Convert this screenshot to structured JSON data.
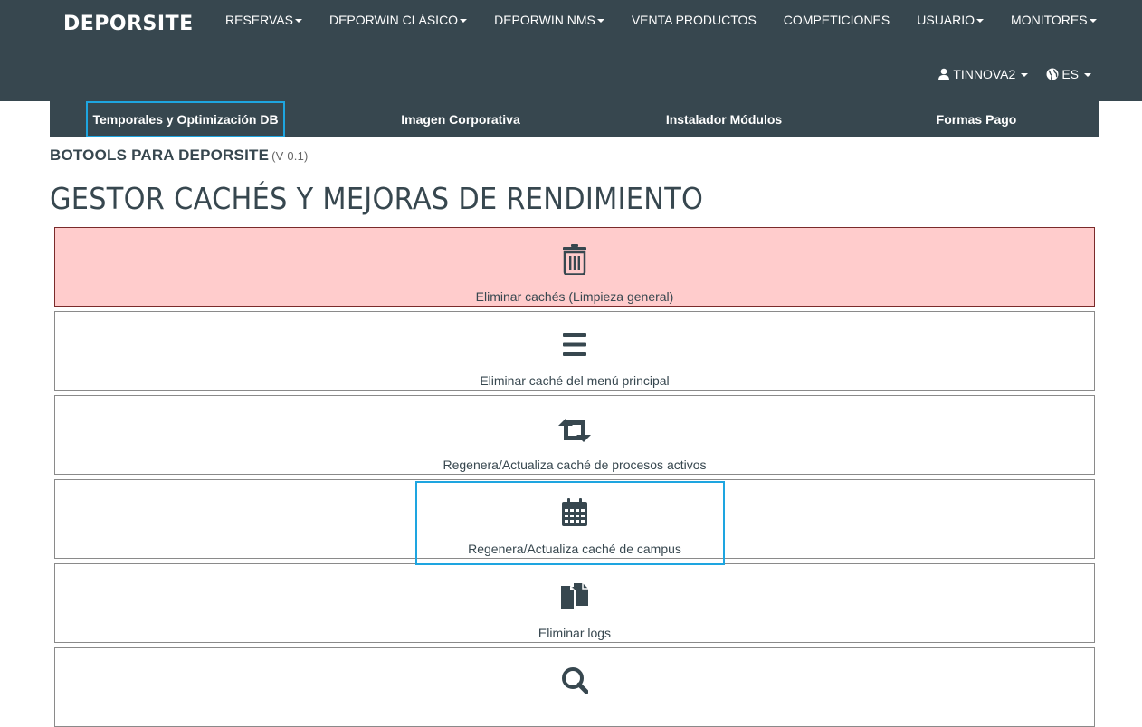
{
  "brand": "DEPORSITE",
  "menu": [
    {
      "label": "RESERVAS",
      "dropdown": true
    },
    {
      "label": "DEPORWIN CLÁSICO",
      "dropdown": true
    },
    {
      "label": "DEPORWIN NMS",
      "dropdown": true
    },
    {
      "label": "VENTA PRODUCTOS",
      "dropdown": false
    },
    {
      "label": "COMPETICIONES",
      "dropdown": false
    },
    {
      "label": "USUARIO",
      "dropdown": true
    },
    {
      "label": "MONITORES",
      "dropdown": true
    }
  ],
  "user": {
    "name": "TINNOVA2",
    "icon": "user-icon"
  },
  "language": {
    "code": "ES",
    "icon": "globe-icon"
  },
  "subtabs": [
    {
      "label": "Temporales y Optimización DB",
      "active": true
    },
    {
      "label": "Imagen Corporativa",
      "active": false
    },
    {
      "label": "Instalador Módulos",
      "active": false
    },
    {
      "label": "Formas Pago",
      "active": false
    }
  ],
  "subtitle": {
    "text": "BOTOOLS PARA DEPORSITE",
    "version": "(V 0.1)"
  },
  "page_title": "GESTOR CACHÉS Y MEJORAS DE RENDIMIENTO",
  "actions": [
    {
      "label": "Eliminar cachés (Limpieza general)",
      "icon": "trash-icon",
      "style": "danger"
    },
    {
      "label": "Eliminar caché del menú principal",
      "icon": "menu-lines-icon",
      "style": "default"
    },
    {
      "label": "Regenera/Actualiza caché de procesos activos",
      "icon": "retweet-icon",
      "style": "default"
    },
    {
      "label": "Regenera/Actualiza caché de campus",
      "icon": "calendar-icon",
      "style": "default"
    },
    {
      "label": "Eliminar logs",
      "icon": "copy-files-icon",
      "style": "default"
    },
    {
      "label": "",
      "icon": "search-icon",
      "style": "default"
    }
  ],
  "colors": {
    "navbar": "#37474f",
    "danger_bg": "#ffcccc",
    "highlight": "#1ea5e0"
  }
}
